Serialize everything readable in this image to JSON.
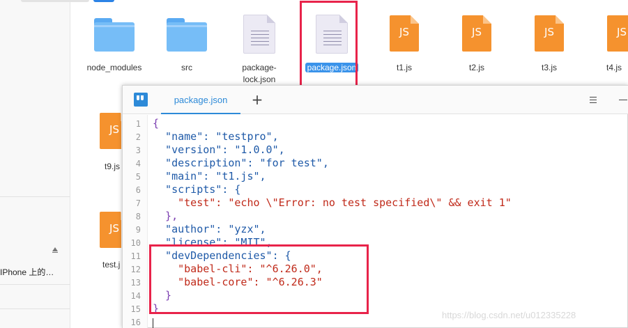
{
  "sidebar": {
    "device_label": "IPhone 上的…"
  },
  "files": [
    {
      "name": "node_modules",
      "type": "folder"
    },
    {
      "name": "src",
      "type": "folder"
    },
    {
      "name": "package-\nlock.json",
      "type": "document"
    },
    {
      "name": "package.json",
      "type": "document",
      "selected": true
    },
    {
      "name": "t1.js",
      "type": "js"
    },
    {
      "name": "t2.js",
      "type": "js"
    },
    {
      "name": "t3.js",
      "type": "js"
    },
    {
      "name": "t4.js",
      "type": "js"
    },
    {
      "name": "t9.js",
      "type": "js"
    },
    {
      "name": "test.j",
      "type": "js"
    }
  ],
  "js_badge": "JS",
  "editor": {
    "tab_label": "package.json",
    "new_tab": "+",
    "menu_icon": "hamburger-icon",
    "lines": [
      "{",
      "  \"name\": \"testpro\",",
      "  \"version\": \"1.0.0\",",
      "  \"description\": \"for test\",",
      "  \"main\": \"t1.js\",",
      "  \"scripts\": {",
      "    \"test\": \"echo \\\"Error: no test specified\\\" && exit 1\"",
      "  },",
      "  \"author\": \"yzx\",",
      "  \"license\": \"MIT\",",
      "  \"devDependencies\": {",
      "    \"babel-cli\": \"^6.26.0\",",
      "    \"babel-core\": \"^6.26.3\"",
      "  }",
      "}",
      ""
    ],
    "line_numbers": [
      "1",
      "2",
      "3",
      "4",
      "5",
      "6",
      "7",
      "8",
      "9",
      "10",
      "11",
      "12",
      "13",
      "14",
      "15",
      "16"
    ]
  },
  "watermark": "https://blog.csdn.net/u012335228",
  "colors": {
    "highlight": "#e8234a",
    "accent": "#2d8ad8",
    "js_orange": "#f5922e",
    "folder_blue": "#76bdf7"
  }
}
